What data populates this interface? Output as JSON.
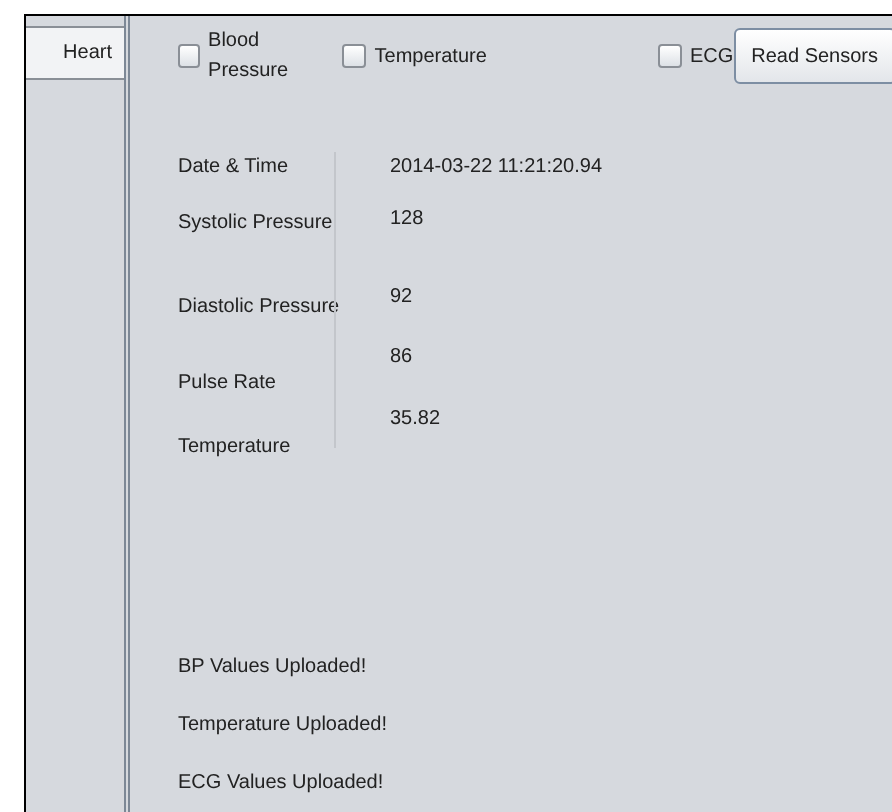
{
  "tabs": [
    {
      "label": "Heart",
      "selected": true
    }
  ],
  "sensors": [
    {
      "label": "Blood Pressure",
      "checked": false
    },
    {
      "label": "Temperature",
      "checked": false
    },
    {
      "label": "ECG",
      "checked": false
    }
  ],
  "read_button": "Read Sensors",
  "readings": [
    {
      "label": "Date & Time",
      "value": "2014-03-22 11:21:20.94"
    },
    {
      "label": "Systolic Pressure",
      "value": "128"
    },
    {
      "label": "Diastolic Pressure",
      "value": "92"
    },
    {
      "label": "Pulse Rate",
      "value": "86"
    },
    {
      "label": "Temperature",
      "value": "35.82"
    }
  ],
  "messages": [
    "BP Values Uploaded!",
    "Temperature Uploaded!",
    "ECG Values Uploaded!"
  ]
}
